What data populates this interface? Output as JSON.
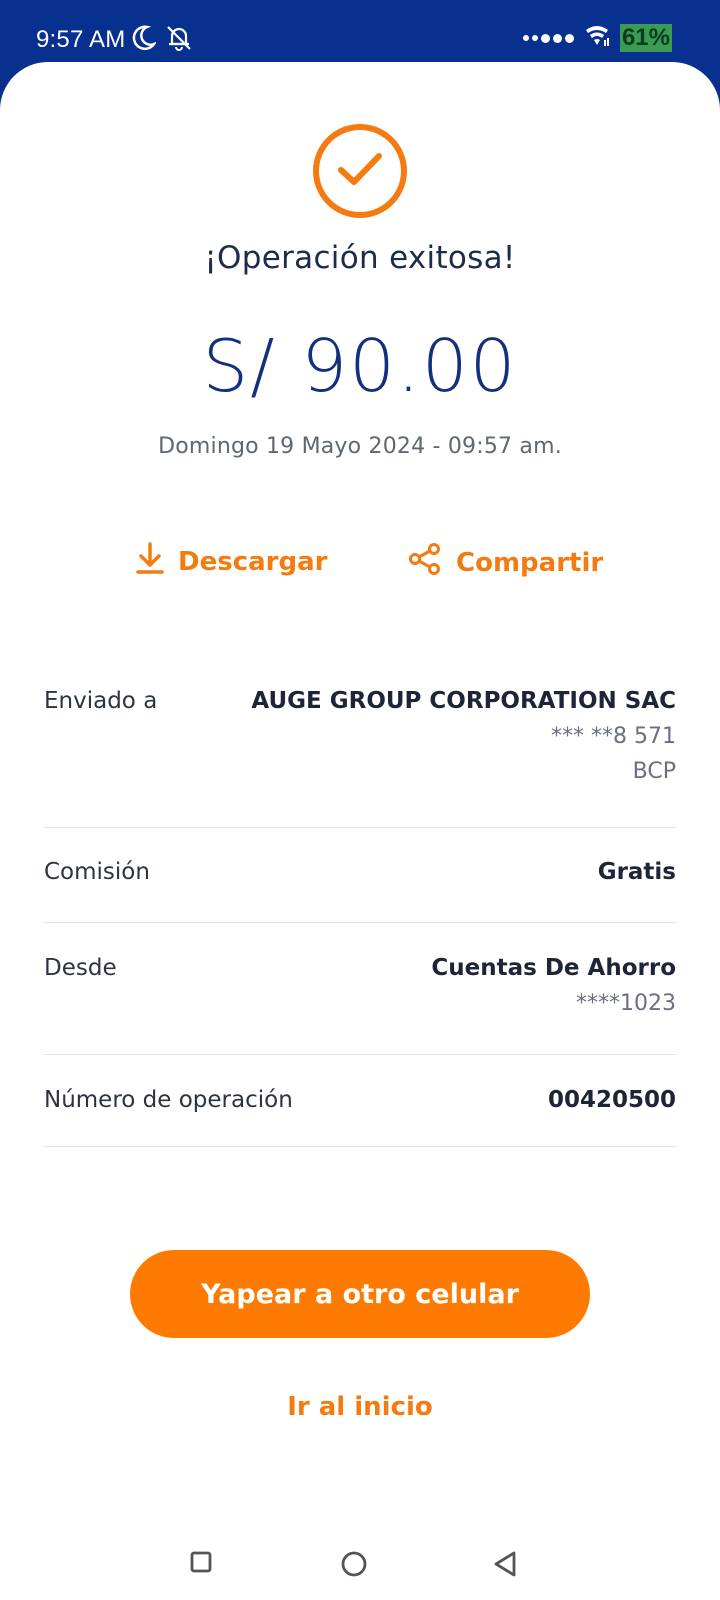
{
  "status_bar": {
    "time": "9:57 AM",
    "battery": "61%",
    "icons": [
      "moon-icon",
      "bell-off-icon",
      "signal-dots-icon",
      "wifi-icon"
    ]
  },
  "result": {
    "status_icon": "check-circle-icon",
    "title": "¡Operación exitosa!",
    "amount": "S/ 90.00",
    "datetime": "Domingo 19 Mayo 2024 - 09:57 am."
  },
  "actions": {
    "download_label": "Descargar",
    "share_label": "Compartir"
  },
  "details": [
    {
      "label": "Enviado a",
      "value": "AUGE GROUP CORPORATION SAC",
      "sub1": "*** **8 571",
      "sub2": "BCP"
    },
    {
      "label": "Comisión",
      "value": "Gratis"
    },
    {
      "label": "Desde",
      "value": "Cuentas De Ahorro",
      "sub1": "****1023"
    },
    {
      "label": "Número de operación",
      "value": "00420500"
    }
  ],
  "buttons": {
    "primary": "Yapear a otro celular",
    "secondary": "Ir al inicio"
  },
  "colors": {
    "accent": "#ff7a00",
    "header_blue": "#07308f",
    "amount_blue": "#13307f"
  }
}
